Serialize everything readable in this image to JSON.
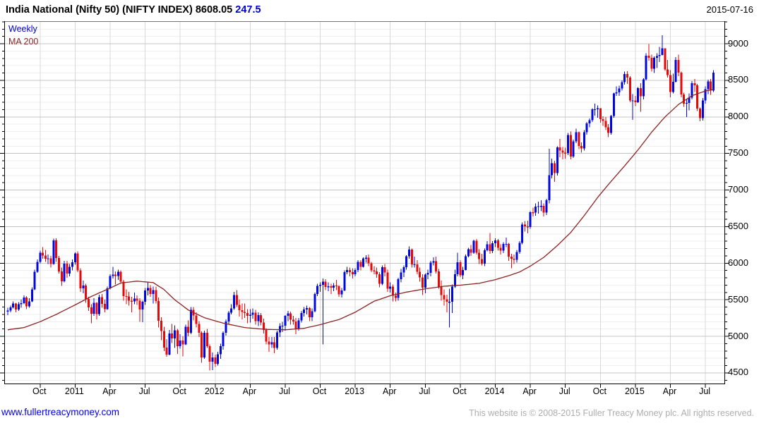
{
  "header": {
    "title_text": "India National (Nifty 50) (NIFTY INDEX)",
    "last_price": "8608.05",
    "change": "247.5",
    "date": "2015-07-16"
  },
  "legend": {
    "timeframe": "Weekly",
    "ma_label": "MA 200"
  },
  "footer": {
    "link": "www.fullertreacymoney.com",
    "copyright": "This website is © 2008-2015 Fuller Treacy Money plc. All rights reserved."
  },
  "colors": {
    "up_candle": "#0008dd",
    "down_candle": "#e80808",
    "ma_line": "#8e2323",
    "grid_minor": "#efefef",
    "grid_major": "#c4c4c4",
    "grid_vertical": "#d8d8d8",
    "axis": "#000000",
    "change_text": "#0000cd",
    "link": "#0000ee",
    "copyright": "#adadad"
  },
  "chart_data": {
    "type": "candlestick",
    "timeframe": "weekly",
    "title": "India National (Nifty 50) (NIFTY INDEX)",
    "last_close": 8608.05,
    "change": 247.5,
    "date_range": [
      "2010-07-09",
      "2015-07-16"
    ],
    "grid": true,
    "legend_position": "top-left",
    "ylim": [
      4355,
      9300
    ],
    "y_major_ticks": [
      4500,
      5000,
      5500,
      6000,
      6500,
      7000,
      7500,
      8000,
      8500,
      9000
    ],
    "y_minor_step": 100,
    "x_ticks": [
      {
        "week": 12,
        "label": "Oct"
      },
      {
        "week": 25,
        "label": "2011"
      },
      {
        "week": 38,
        "label": "Apr"
      },
      {
        "week": 51,
        "label": "Jul"
      },
      {
        "week": 64,
        "label": "Oct"
      },
      {
        "week": 77,
        "label": "2012"
      },
      {
        "week": 90,
        "label": "Apr"
      },
      {
        "week": 103,
        "label": "Jul"
      },
      {
        "week": 116,
        "label": "Oct"
      },
      {
        "week": 129,
        "label": "2013"
      },
      {
        "week": 142,
        "label": "Apr"
      },
      {
        "week": 155,
        "label": "Jul"
      },
      {
        "week": 168,
        "label": "Oct"
      },
      {
        "week": 181,
        "label": "2014"
      },
      {
        "week": 194,
        "label": "Apr"
      },
      {
        "week": 207,
        "label": "Jul"
      },
      {
        "week": 220,
        "label": "Oct"
      },
      {
        "week": 233,
        "label": "2015"
      },
      {
        "week": 246,
        "label": "Apr"
      },
      {
        "week": 259,
        "label": "Jul"
      }
    ],
    "series_note": "weeks = [high, low, close] per week; open = previous close",
    "weeks": [
      [
        5390,
        5290,
        5352
      ],
      [
        5420,
        5330,
        5394
      ],
      [
        5480,
        5380,
        5449
      ],
      [
        5460,
        5330,
        5368
      ],
      [
        5470,
        5350,
        5439
      ],
      [
        5500,
        5390,
        5452
      ],
      [
        5560,
        5440,
        5530
      ],
      [
        5550,
        5370,
        5409
      ],
      [
        5520,
        5390,
        5479
      ],
      [
        5670,
        5470,
        5640
      ],
      [
        5910,
        5630,
        5885
      ],
      [
        6050,
        5870,
        6018
      ],
      [
        6170,
        6000,
        6143
      ],
      [
        6220,
        6060,
        6103
      ],
      [
        6180,
        6020,
        6062
      ],
      [
        6120,
        5990,
        6066
      ],
      [
        6100,
        5940,
        5988
      ],
      [
        6338,
        5980,
        6312
      ],
      [
        6340,
        6020,
        6072
      ],
      [
        6100,
        5860,
        5890
      ],
      [
        5940,
        5690,
        5752
      ],
      [
        6030,
        5740,
        5993
      ],
      [
        6030,
        5800,
        5857
      ],
      [
        5990,
        5820,
        5948
      ],
      [
        6050,
        5900,
        6012
      ],
      [
        6150,
        5980,
        6134
      ],
      [
        6160,
        5880,
        5904
      ],
      [
        5930,
        5610,
        5654
      ],
      [
        5760,
        5590,
        5696
      ],
      [
        5720,
        5460,
        5512
      ],
      [
        5540,
        5350,
        5396
      ],
      [
        5440,
        5178,
        5310
      ],
      [
        5520,
        5280,
        5459
      ],
      [
        5470,
        5230,
        5303
      ],
      [
        5570,
        5280,
        5538
      ],
      [
        5580,
        5390,
        5445
      ],
      [
        5500,
        5330,
        5374
      ],
      [
        5680,
        5360,
        5654
      ],
      [
        5850,
        5640,
        5826
      ],
      [
        5950,
        5790,
        5842
      ],
      [
        5890,
        5710,
        5825
      ],
      [
        5910,
        5770,
        5885
      ],
      [
        5900,
        5720,
        5749
      ],
      [
        5770,
        5490,
        5551
      ],
      [
        5640,
        5440,
        5544
      ],
      [
        5610,
        5420,
        5486
      ],
      [
        5540,
        5330,
        5476
      ],
      [
        5600,
        5440,
        5517
      ],
      [
        5560,
        5430,
        5486
      ],
      [
        5520,
        5200,
        5366
      ],
      [
        5490,
        5195,
        5471
      ],
      [
        5660,
        5430,
        5627
      ],
      [
        5740,
        5560,
        5660
      ],
      [
        5700,
        5540,
        5581
      ],
      [
        5680,
        5450,
        5634
      ],
      [
        5680,
        5450,
        5482
      ],
      [
        5530,
        5120,
        5212
      ],
      [
        5260,
        4950,
        5073
      ],
      [
        5130,
        4800,
        4846
      ],
      [
        4960,
        4720,
        4748
      ],
      [
        5090,
        4740,
        5040
      ],
      [
        5170,
        4910,
        4970
      ],
      [
        5150,
        4840,
        5084
      ],
      [
        5100,
        4760,
        4868
      ],
      [
        5030,
        4830,
        4943
      ],
      [
        5000,
        4728,
        4888
      ],
      [
        5160,
        4880,
        5132
      ],
      [
        5220,
        5000,
        5049
      ],
      [
        5400,
        5030,
        5360
      ],
      [
        5400,
        5220,
        5284
      ],
      [
        5330,
        5120,
        5169
      ],
      [
        5210,
        4990,
        5049
      ],
      [
        5070,
        4640,
        4710
      ],
      [
        5080,
        4690,
        5050
      ],
      [
        5100,
        4840,
        4867
      ],
      [
        4890,
        4531,
        4652
      ],
      [
        4780,
        4540,
        4714
      ],
      [
        4750,
        4580,
        4624
      ],
      [
        4790,
        4600,
        4754
      ],
      [
        4900,
        4690,
        4866
      ],
      [
        5070,
        4820,
        5049
      ],
      [
        5230,
        5010,
        5205
      ],
      [
        5350,
        5160,
        5326
      ],
      [
        5440,
        5300,
        5382
      ],
      [
        5610,
        5360,
        5565
      ],
      [
        5630,
        5400,
        5429
      ],
      [
        5500,
        5270,
        5359
      ],
      [
        5450,
        5230,
        5334
      ],
      [
        5450,
        5250,
        5318
      ],
      [
        5370,
        5180,
        5278
      ],
      [
        5370,
        5190,
        5296
      ],
      [
        5380,
        5240,
        5322
      ],
      [
        5360,
        5160,
        5207
      ],
      [
        5330,
        5140,
        5291
      ],
      [
        5320,
        5150,
        5191
      ],
      [
        5240,
        5040,
        5086
      ],
      [
        5110,
        4890,
        4929
      ],
      [
        4990,
        4790,
        4892
      ],
      [
        4990,
        4840,
        4921
      ],
      [
        4990,
        4770,
        4841
      ],
      [
        5080,
        4820,
        5054
      ],
      [
        5180,
        4990,
        5139
      ],
      [
        5200,
        5060,
        5146
      ],
      [
        5290,
        5080,
        5279
      ],
      [
        5350,
        5210,
        5316
      ],
      [
        5340,
        5160,
        5227
      ],
      [
        5280,
        5160,
        5205
      ],
      [
        5250,
        5030,
        5100
      ],
      [
        5250,
        5080,
        5216
      ],
      [
        5350,
        5190,
        5320
      ],
      [
        5400,
        5270,
        5366
      ],
      [
        5420,
        5300,
        5387
      ],
      [
        5400,
        5210,
        5259
      ],
      [
        5380,
        5210,
        5342
      ],
      [
        5600,
        5330,
        5578
      ],
      [
        5720,
        5550,
        5691
      ],
      [
        5740,
        5610,
        5703
      ],
      [
        5790,
        4888,
        5747
      ],
      [
        5780,
        5630,
        5676
      ],
      [
        5740,
        5620,
        5684
      ],
      [
        5720,
        5580,
        5664
      ],
      [
        5730,
        5620,
        5697
      ],
      [
        5770,
        5630,
        5686
      ],
      [
        5700,
        5540,
        5574
      ],
      [
        5660,
        5530,
        5627
      ],
      [
        5900,
        5620,
        5879
      ],
      [
        5950,
        5850,
        5907
      ],
      [
        5940,
        5820,
        5880
      ],
      [
        5930,
        5790,
        5847
      ],
      [
        5930,
        5820,
        5908
      ],
      [
        6040,
        5880,
        6016
      ],
      [
        6040,
        5900,
        5951
      ],
      [
        6080,
        5940,
        6064
      ],
      [
        6110,
        6010,
        6074
      ],
      [
        6120,
        5960,
        5998
      ],
      [
        6020,
        5880,
        5903
      ],
      [
        5960,
        5850,
        5887
      ],
      [
        5940,
        5800,
        5850
      ],
      [
        5880,
        5670,
        5720
      ],
      [
        5970,
        5700,
        5946
      ],
      [
        5990,
        5820,
        5872
      ],
      [
        5910,
        5610,
        5651
      ],
      [
        5740,
        5600,
        5682
      ],
      [
        5710,
        5480,
        5553
      ],
      [
        5600,
        5477,
        5528
      ],
      [
        5800,
        5490,
        5783
      ],
      [
        5920,
        5740,
        5871
      ],
      [
        5970,
        5810,
        5944
      ],
      [
        6110,
        5910,
        6094
      ],
      [
        6229,
        6060,
        6187
      ],
      [
        6200,
        5940,
        5983
      ],
      [
        6090,
        5940,
        5986
      ],
      [
        6040,
        5850,
        5881
      ],
      [
        5940,
        5750,
        5808
      ],
      [
        5850,
        5566,
        5667
      ],
      [
        5860,
        5590,
        5842
      ],
      [
        5910,
        5780,
        5868
      ],
      [
        6030,
        5820,
        6009
      ],
      [
        6080,
        5970,
        6029
      ],
      [
        6090,
        5860,
        5886
      ],
      [
        5920,
        5650,
        5678
      ],
      [
        5760,
        5490,
        5565
      ],
      [
        5640,
        5420,
        5508
      ],
      [
        5570,
        5330,
        5471
      ],
      [
        5650,
        5119,
        5472
      ],
      [
        5710,
        5320,
        5680
      ],
      [
        5910,
        5660,
        5851
      ],
      [
        6142,
        5820,
        6012
      ],
      [
        6040,
        5810,
        5833
      ],
      [
        5950,
        5780,
        5908
      ],
      [
        6120,
        5900,
        6096
      ],
      [
        6210,
        6080,
        6189
      ],
      [
        6250,
        6100,
        6144
      ],
      [
        6320,
        6130,
        6307
      ],
      [
        6330,
        6120,
        6141
      ],
      [
        6190,
        5990,
        6056
      ],
      [
        6130,
        5970,
        5996
      ],
      [
        6200,
        5960,
        6176
      ],
      [
        6300,
        6160,
        6260
      ],
      [
        6415,
        6130,
        6168
      ],
      [
        6300,
        6140,
        6274
      ],
      [
        6340,
        6220,
        6314
      ],
      [
        6330,
        6170,
        6211
      ],
      [
        6260,
        6120,
        6171
      ],
      [
        6290,
        6140,
        6262
      ],
      [
        6350,
        6220,
        6266
      ],
      [
        6280,
        6030,
        6090
      ],
      [
        6130,
        5933,
        6063
      ],
      [
        6120,
        5990,
        6048
      ],
      [
        6180,
        6010,
        6155
      ],
      [
        6300,
        6130,
        6277
      ],
      [
        6560,
        6260,
        6527
      ],
      [
        6575,
        6430,
        6504
      ],
      [
        6580,
        6410,
        6493
      ],
      [
        6710,
        6470,
        6696
      ],
      [
        6760,
        6640,
        6694
      ],
      [
        6820,
        6650,
        6776
      ],
      [
        6840,
        6680,
        6779
      ],
      [
        6860,
        6710,
        6783
      ],
      [
        6820,
        6640,
        6694
      ],
      [
        6880,
        6660,
        6859
      ],
      [
        7563,
        6820,
        7203
      ],
      [
        7430,
        7160,
        7367
      ],
      [
        7400,
        7110,
        7230
      ],
      [
        7600,
        7200,
        7584
      ],
      [
        7700,
        7450,
        7542
      ],
      [
        7590,
        7420,
        7511
      ],
      [
        7580,
        7430,
        7508
      ],
      [
        7780,
        7480,
        7751
      ],
      [
        7800,
        7420,
        7460
      ],
      [
        7690,
        7440,
        7664
      ],
      [
        7840,
        7640,
        7790
      ],
      [
        7800,
        7560,
        7602
      ],
      [
        7650,
        7510,
        7568
      ],
      [
        7820,
        7540,
        7792
      ],
      [
        7930,
        7760,
        7913
      ],
      [
        7980,
        7860,
        7954
      ],
      [
        8120,
        7930,
        8105
      ],
      [
        8180,
        8020,
        8106
      ],
      [
        8160,
        7990,
        8121
      ],
      [
        8110,
        7920,
        7968
      ],
      [
        8010,
        7880,
        7946
      ],
      [
        8000,
        7820,
        7860
      ],
      [
        7900,
        7724,
        7780
      ],
      [
        8030,
        7760,
        8014
      ],
      [
        8330,
        7990,
        8322
      ],
      [
        8420,
        8290,
        8337
      ],
      [
        8430,
        8290,
        8390
      ],
      [
        8500,
        8360,
        8477
      ],
      [
        8620,
        8440,
        8588
      ],
      [
        8627,
        8450,
        8538
      ],
      [
        8560,
        8200,
        8224
      ],
      [
        8310,
        7961,
        8225
      ],
      [
        8290,
        8150,
        8201
      ],
      [
        8410,
        8190,
        8395
      ],
      [
        8460,
        8070,
        8285
      ],
      [
        8530,
        8240,
        8514
      ],
      [
        8870,
        8500,
        8836
      ],
      [
        8997,
        8770,
        8809
      ],
      [
        8850,
        8620,
        8661
      ],
      [
        8830,
        8600,
        8806
      ],
      [
        8870,
        8670,
        8834
      ],
      [
        8960,
        8750,
        8845
      ],
      [
        9119,
        8840,
        8938
      ],
      [
        8940,
        8630,
        8648
      ],
      [
        8780,
        8540,
        8571
      ],
      [
        8640,
        8270,
        8342
      ],
      [
        8590,
        8320,
        8480
      ],
      [
        8820,
        8470,
        8780
      ],
      [
        8850,
        8560,
        8606
      ],
      [
        8620,
        8270,
        8305
      ],
      [
        8330,
        8140,
        8182
      ],
      [
        8240,
        7997,
        8191
      ],
      [
        8320,
        8090,
        8262
      ],
      [
        8490,
        8240,
        8459
      ],
      [
        8520,
        8340,
        8434
      ],
      [
        8450,
        8080,
        8115
      ],
      [
        8130,
        7940,
        7983
      ],
      [
        8260,
        7950,
        8225
      ],
      [
        8420,
        8180,
        8381
      ],
      [
        8510,
        8310,
        8485
      ],
      [
        8520,
        8300,
        8360
      ],
      [
        8640,
        8340,
        8608.05
      ]
    ],
    "ma200_anchors": [
      [
        0,
        5090
      ],
      [
        6,
        5120
      ],
      [
        12,
        5200
      ],
      [
        18,
        5300
      ],
      [
        25,
        5430
      ],
      [
        31,
        5545
      ],
      [
        38,
        5660
      ],
      [
        42,
        5730
      ],
      [
        48,
        5755
      ],
      [
        54,
        5735
      ],
      [
        58,
        5640
      ],
      [
        62,
        5500
      ],
      [
        67,
        5360
      ],
      [
        73,
        5255
      ],
      [
        80,
        5180
      ],
      [
        88,
        5120
      ],
      [
        96,
        5095
      ],
      [
        103,
        5090
      ],
      [
        110,
        5110
      ],
      [
        116,
        5160
      ],
      [
        123,
        5230
      ],
      [
        129,
        5330
      ],
      [
        136,
        5480
      ],
      [
        142,
        5555
      ],
      [
        148,
        5605
      ],
      [
        155,
        5650
      ],
      [
        162,
        5685
      ],
      [
        168,
        5700
      ],
      [
        175,
        5725
      ],
      [
        181,
        5775
      ],
      [
        186,
        5830
      ],
      [
        190,
        5880
      ],
      [
        194,
        5960
      ],
      [
        199,
        6080
      ],
      [
        204,
        6240
      ],
      [
        209,
        6420
      ],
      [
        214,
        6650
      ],
      [
        219,
        6900
      ],
      [
        224,
        7120
      ],
      [
        229,
        7330
      ],
      [
        234,
        7550
      ],
      [
        239,
        7790
      ],
      [
        244,
        8000
      ],
      [
        249,
        8170
      ],
      [
        254,
        8290
      ],
      [
        259,
        8355
      ],
      [
        262,
        8375
      ]
    ]
  }
}
